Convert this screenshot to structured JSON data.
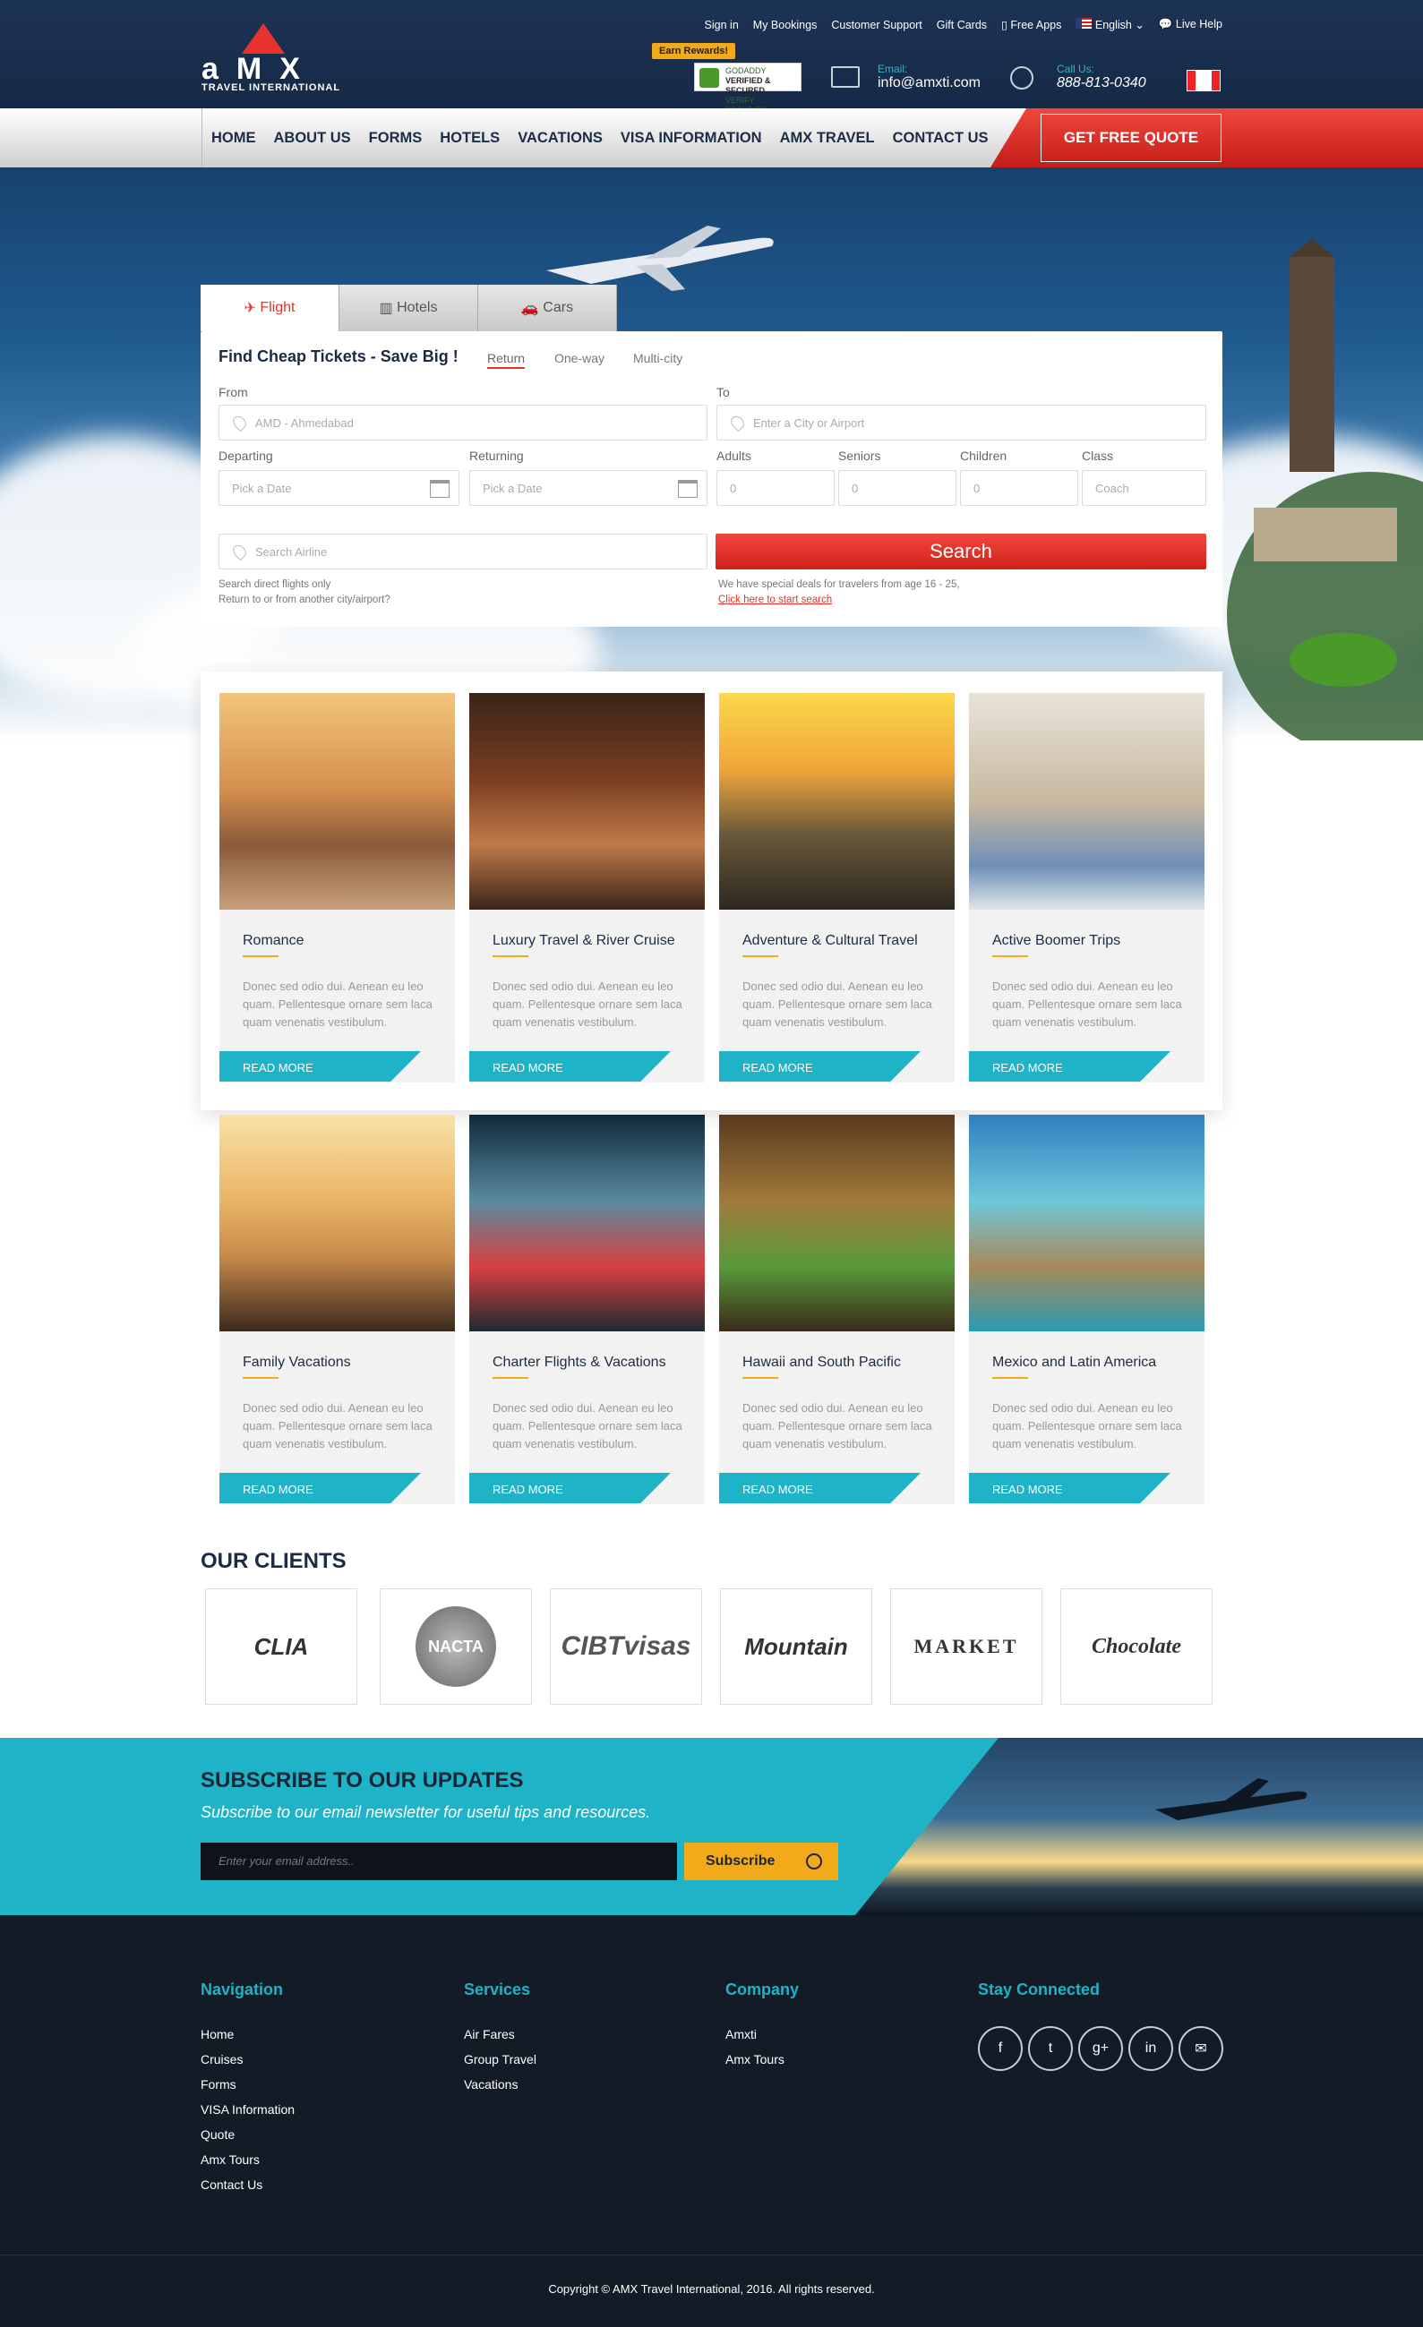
{
  "header": {
    "logo_text": "aMX",
    "logo_sub": "TRAVEL INTERNATIONAL",
    "top_links": [
      "Sign in",
      "My Bookings",
      "Customer Support",
      "Gift Cards",
      "Free Apps",
      "English",
      "Live Help"
    ],
    "rewards": "Earn Rewards!",
    "badge_line1": "GODADDY",
    "badge_line2": "VERIFIED & SECURED",
    "badge_line3": "VERIFY SECURITY",
    "email_label": "Email:",
    "email": "info@amxti.com",
    "call_label": "Call Us:",
    "phone": "888-813-0340"
  },
  "nav": {
    "items": [
      "HOME",
      "ABOUT US",
      "FORMS",
      "HOTELS",
      "VACATIONS",
      "VISA INFORMATION",
      "AMX TRAVEL",
      "CONTACT US"
    ],
    "quote": "GET FREE QUOTE"
  },
  "search": {
    "tabs": [
      "Flight",
      "Hotels",
      "Cars"
    ],
    "title": "Find Cheap Tickets - Save Big !",
    "trip_types": [
      "Return",
      "One-way",
      "Multi-city"
    ],
    "from_label": "From",
    "from_value": "AMD - Ahmedabad",
    "to_label": "To",
    "to_placeholder": "Enter a City  or  Airport",
    "departing_label": "Departing",
    "returning_label": "Returning",
    "date_placeholder": "Pick a Date",
    "adults_label": "Adults",
    "seniors_label": "Seniors",
    "children_label": "Children",
    "class_label": "Class",
    "count_value": "0",
    "class_value": "Coach",
    "airline_placeholder": "Search Airline",
    "note1": "Search direct flights only",
    "note2": "Return to or from another city/airport?",
    "search_btn": "Search",
    "deal_note": "We have special deals for travelers from age 16 - 25,",
    "deal_link": "Click here to start search"
  },
  "cards": {
    "lorem": "Donec sed odio dui. Aenean eu leo quam. Pellentesque ornare sem laca quam venenatis vestibulum.",
    "read_more": "READ MORE",
    "titles": [
      "Romance",
      "Luxury Travel & River Cruise",
      "Adventure & Cultural Travel",
      "Active Boomer Trips",
      "Family Vacations",
      "Charter Flights & Vacations",
      "Hawaii and South Pacific",
      "Mexico and Latin America"
    ]
  },
  "clients": {
    "title": "OUR CLIENTS",
    "logos": [
      "CLIA",
      "NACTA",
      "CIBTvisas",
      "Mountain",
      "MARKET",
      "Chocolate"
    ]
  },
  "subscribe": {
    "title": "SUBSCRIBE TO OUR UPDATES",
    "subtitle": "Subscribe to our email newsletter for useful tips and resources.",
    "placeholder": "Enter your email address..",
    "button": "Subscribe"
  },
  "footer": {
    "nav_title": "Navigation",
    "nav_items": [
      "Home",
      "Cruises",
      "Forms",
      "VISA Information",
      "Quote",
      "Amx Tours",
      "Contact Us"
    ],
    "services_title": "Services",
    "services_items": [
      "Air Fares",
      "Group Travel",
      "Vacations"
    ],
    "company_title": "Company",
    "company_items": [
      "Amxti",
      "Amx Tours"
    ],
    "social_title": "Stay Connected",
    "social": [
      "f",
      "t",
      "g+",
      "in",
      "✉"
    ],
    "copyright": "Copyright © AMX Travel International, 2016. All rights reserved."
  },
  "colors": {
    "navy": "#1d3354",
    "red": "#e63329",
    "teal": "#1fb3c7",
    "gold": "#f2a91a"
  }
}
